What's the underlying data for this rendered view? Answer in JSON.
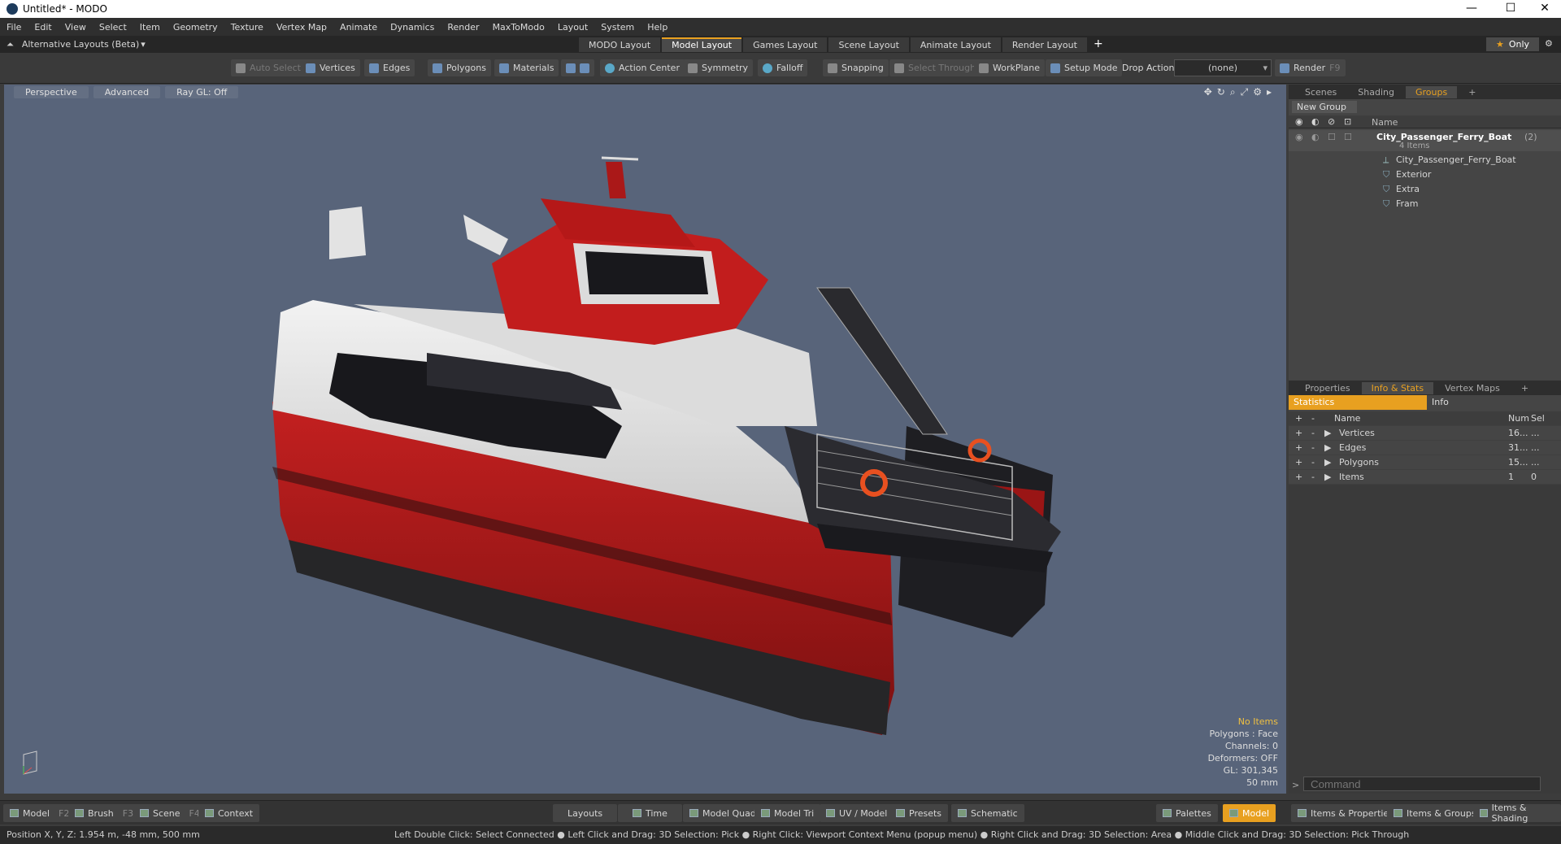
{
  "window": {
    "title": "Untitled* - MODO",
    "controls": [
      "—",
      "☐",
      "✕"
    ]
  },
  "menu": [
    "File",
    "Edit",
    "View",
    "Select",
    "Item",
    "Geometry",
    "Texture",
    "Vertex Map",
    "Animate",
    "Dynamics",
    "Render",
    "MaxToModo",
    "Layout",
    "System",
    "Help"
  ],
  "layoutbar": {
    "alt_layouts": "Alternative Layouts (Beta)",
    "tabs": [
      "MODO Layout",
      "Model Layout",
      "Games Layout",
      "Scene Layout",
      "Animate Layout",
      "Render Layout"
    ],
    "active_tab": "Model Layout",
    "only": "Only"
  },
  "toolbar": {
    "auto_select": "Auto Select",
    "vertices": "Vertices",
    "edges": "Edges",
    "polygons": "Polygons",
    "materials": "Materials",
    "action_center": "Action Center",
    "symmetry": "Symmetry",
    "falloff": "Falloff",
    "snapping": "Snapping",
    "select_through": "Select Through",
    "workplane": "WorkPlane",
    "setup_mode": "Setup Mode",
    "drop_action": "Drop Action",
    "drop_value": "(none)",
    "render": "Render",
    "render_key": "F9"
  },
  "viewport": {
    "perspective": "Perspective",
    "advanced": "Advanced",
    "ray_gl": "Ray GL: Off",
    "info": {
      "no_items": "No Items",
      "polygons": "Polygons : Face",
      "channels": "Channels: 0",
      "deformers": "Deformers: OFF",
      "gl": "GL: 301,345",
      "scale": "50 mm"
    }
  },
  "groups": {
    "tabs": [
      "Scenes",
      "Shading",
      "Groups"
    ],
    "active": "Groups",
    "new_group": "New Group",
    "name_header": "Name",
    "root": {
      "name": "City_Passenger_Ferry_Boat",
      "count": "(2)",
      "sub": "4 Items"
    },
    "children": [
      "City_Passenger_Ferry_Boat",
      "Exterior",
      "Extra",
      "Fram"
    ]
  },
  "info": {
    "tabs": [
      "Properties",
      "Info & Stats",
      "Vertex Maps"
    ],
    "active": "Info & Stats",
    "statistics": "Statistics",
    "info": "Info",
    "headers": {
      "name": "Name",
      "num": "Num",
      "sel": "Sel"
    },
    "rows": [
      {
        "name": "Vertices",
        "num": "16...",
        "sel": "..."
      },
      {
        "name": "Edges",
        "num": "31...",
        "sel": "..."
      },
      {
        "name": "Polygons",
        "num": "15...",
        "sel": "..."
      },
      {
        "name": "Items",
        "num": "1",
        "sel": "0"
      }
    ],
    "command_placeholder": "Command"
  },
  "bottom": {
    "model": "Model",
    "model_key": "F2",
    "brush": "Brush",
    "brush_key": "F3",
    "scene": "Scene",
    "scene_key": "F4",
    "context": "Context",
    "layouts": "Layouts",
    "time": "Time",
    "model_quad": "Model Quad",
    "model_tri": "Model Tri",
    "uv_model": "UV / Model",
    "presets": "Presets",
    "schematic": "Schematic",
    "palettes": "Palettes",
    "model_active": "Model",
    "items_props": "Items & Properties",
    "items_groups": "Items & Groups",
    "items_shading": "Items & Shading"
  },
  "status": {
    "position": "Position X, Y, Z:   1.954 m, -48 mm, 500 mm",
    "hint": "Left Double Click: Select Connected ● Left Click and Drag: 3D Selection: Pick ● Right Click: Viewport Context Menu (popup menu) ● Right Click and Drag: 3D Selection: Area ● Middle Click and Drag: 3D Selection: Pick Through"
  }
}
